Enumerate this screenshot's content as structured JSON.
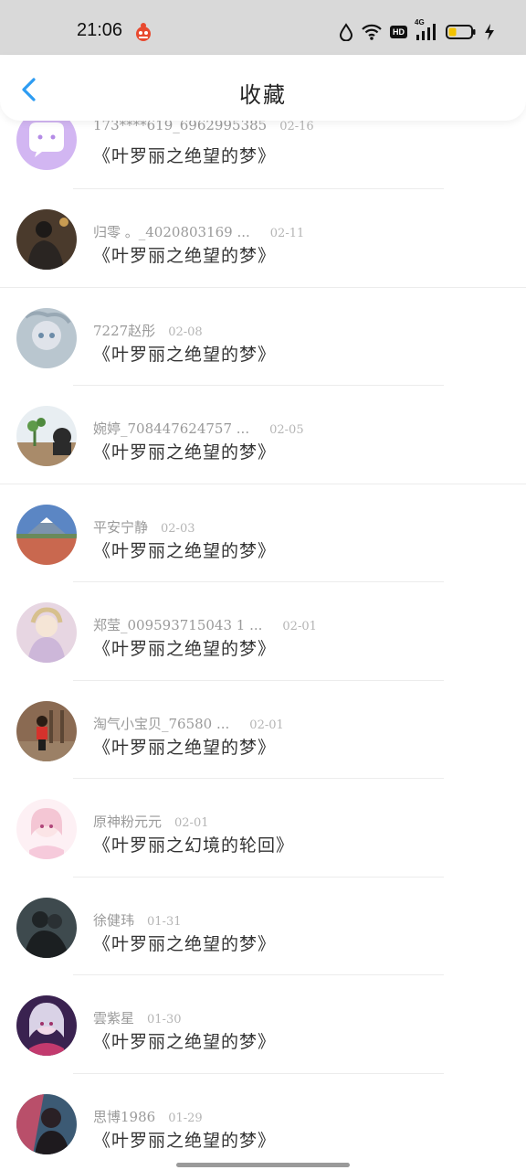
{
  "status_bar": {
    "time": "21:06",
    "hd": "HD",
    "network": "4G",
    "battery_level": 0.35
  },
  "header": {
    "title": "收藏",
    "back_icon": "chevron-left-icon",
    "accent_color": "#2d9cf2"
  },
  "list": [
    {
      "name": "173****619_6962995385",
      "date": "02-16",
      "title": "《叶罗丽之绝望的梦》"
    },
    {
      "name": "归零 。_4020803169 ...",
      "date": "02-11",
      "title": "《叶罗丽之绝望的梦》"
    },
    {
      "name": "7227赵彤",
      "date": "02-08",
      "title": "《叶罗丽之绝望的梦》"
    },
    {
      "name": "婉婷_708447624757 ...",
      "date": "02-05",
      "title": "《叶罗丽之绝望的梦》"
    },
    {
      "name": "平安宁静",
      "date": "02-03",
      "title": "《叶罗丽之绝望的梦》"
    },
    {
      "name": "郑莹_009593715043 1 ...",
      "date": "02-01",
      "title": "《叶罗丽之绝望的梦》"
    },
    {
      "name": "淘气小宝贝_76580 ...",
      "date": "02-01",
      "title": "《叶罗丽之绝望的梦》"
    },
    {
      "name": "原神粉元元",
      "date": "02-01",
      "title": "《叶罗丽之幻境的轮回》"
    },
    {
      "name": "徐健玮",
      "date": "01-31",
      "title": "《叶罗丽之绝望的梦》"
    },
    {
      "name": "雲紫星",
      "date": "01-30",
      "title": "《叶罗丽之绝望的梦》"
    },
    {
      "name": "思博1986",
      "date": "01-29",
      "title": "《叶罗丽之绝望的梦》"
    }
  ]
}
